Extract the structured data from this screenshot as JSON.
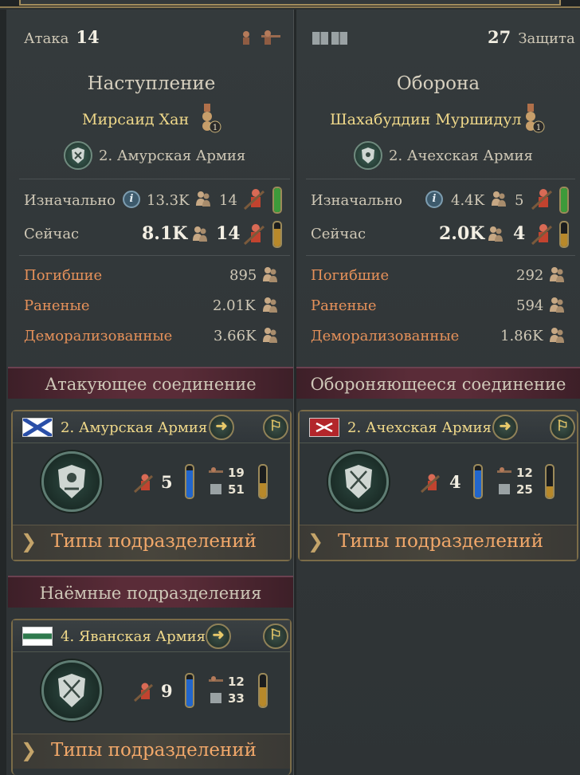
{
  "attack": {
    "label": "Атака",
    "value": "14"
  },
  "defense": {
    "label": "Защита",
    "value": "27"
  },
  "left": {
    "side_title": "Наступление",
    "commander": "Мирсаид Хан",
    "commander_rank": "1",
    "army": "2. Амурская Армия",
    "initial_label": "Изначально",
    "initial_men": "13.3K",
    "initial_units": "14",
    "now_label": "Сейчас",
    "now_men": "8.1K",
    "now_units": "14",
    "killed_label": "Погибшие",
    "killed": "895",
    "wounded_label": "Раненые",
    "wounded": "2.01K",
    "demoralized_label": "Деморализованные",
    "demoralized": "3.66K",
    "morale_initial": 1.0,
    "morale_now": 0.75
  },
  "right": {
    "side_title": "Оборона",
    "commander": "Шахабуддин Муршидул",
    "commander_rank": "1",
    "army": "2. Ачехская Армия",
    "initial_label": "Изначально",
    "initial_men": "4.4K",
    "initial_units": "5",
    "now_label": "Сейчас",
    "now_men": "2.0K",
    "now_units": "4",
    "killed_label": "Погибшие",
    "killed": "292",
    "wounded_label": "Раненые",
    "wounded": "594",
    "demoralized_label": "Деморализованные",
    "demoralized": "1.86K",
    "morale_initial": 1.0,
    "morale_now": 0.55
  },
  "attacking_formation": {
    "banner": "Атакующее соединение",
    "army": "2. Амурская Армия",
    "units": "5",
    "stat_a": "19",
    "stat_b": "51",
    "organization": 0.85,
    "morale": 0.45,
    "subtypes_label": "Типы подразделений"
  },
  "defending_formation": {
    "banner": "Обороняющееся соединение",
    "army": "2. Ачехская Армия",
    "units": "4",
    "stat_a": "12",
    "stat_b": "25",
    "organization": 0.85,
    "morale": 0.35,
    "subtypes_label": "Типы подразделений"
  },
  "mercenary": {
    "banner": "Наёмные подразделения",
    "army": "4. Яванская Армия",
    "units": "9",
    "stat_a": "12",
    "stat_b": "33",
    "organization": 0.85,
    "morale": 0.6,
    "subtypes_label": "Типы подразделений"
  },
  "colors": {
    "manpower_full": "#3d9a3a",
    "manpower_partial": "#b8892a",
    "organization": "#2266cc",
    "morale": "#b8892a",
    "loss_label": "#e6915a",
    "commander_name": "#f0d98a"
  }
}
